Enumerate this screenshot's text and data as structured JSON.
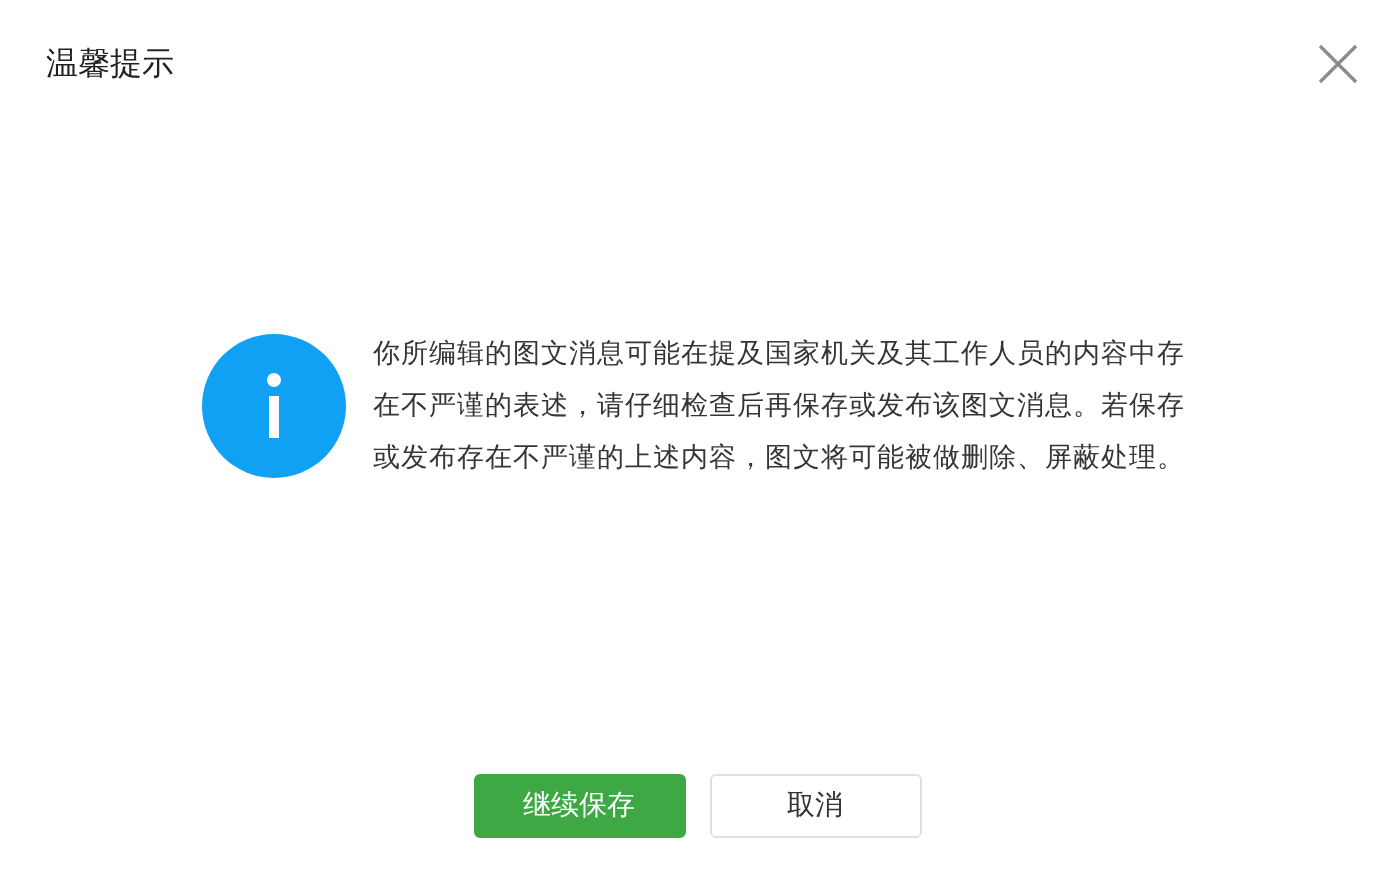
{
  "dialog": {
    "title": "温馨提示",
    "message": "你所编辑的图文消息可能在提及国家机关及其工作人员的内容中存在不严谨的表述，请仔细检查后再保存或发布该图文消息。若保存或发布存在不严谨的上述内容，图文将可能被做删除、屏蔽处理。"
  },
  "buttons": [
    {
      "label": "继续保存",
      "kind": "primary"
    },
    {
      "label": "取消",
      "kind": "default"
    }
  ]
}
